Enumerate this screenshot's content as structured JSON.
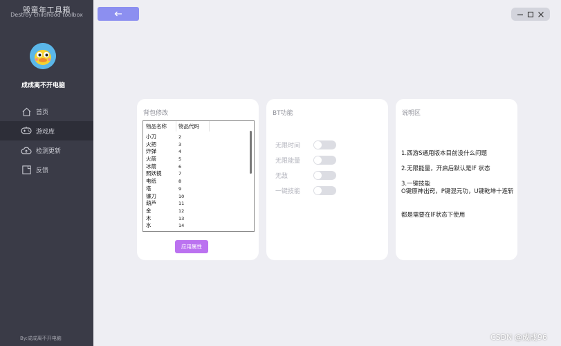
{
  "app": {
    "title": "毁童年工具箱",
    "subtitle": "Destroy childhood toolbox"
  },
  "user": {
    "name": "成成离不开电脑"
  },
  "sidebar": {
    "items": [
      {
        "label": "首页",
        "icon": "home-icon"
      },
      {
        "label": "游戏库",
        "icon": "gamepad-icon"
      },
      {
        "label": "检测更新",
        "icon": "cloud-icon"
      },
      {
        "label": "反馈",
        "icon": "feedback-icon"
      }
    ],
    "active_index": 1,
    "footer": "By:成成离不开电脑"
  },
  "backpack": {
    "title": "背包修改",
    "headers": [
      "物品名称",
      "物品代码"
    ],
    "rows": [
      [
        "小刀",
        "2"
      ],
      [
        "火把",
        "3"
      ],
      [
        "炸弹",
        "4"
      ],
      [
        "火箭",
        "5"
      ],
      [
        "冰箭",
        "6"
      ],
      [
        "照妖镜",
        "7"
      ],
      [
        "电纸",
        "8"
      ],
      [
        "塔",
        "9"
      ],
      [
        "镰刀",
        "10"
      ],
      [
        "葫芦",
        "11"
      ],
      [
        "金",
        "12"
      ],
      [
        "木",
        "13"
      ],
      [
        "水",
        "14"
      ]
    ],
    "apply_label": "应用属性"
  },
  "bt": {
    "title": "BT功能",
    "toggles": [
      {
        "label": "无限时间",
        "on": false
      },
      {
        "label": "无限能量",
        "on": false
      },
      {
        "label": "无敌",
        "on": false
      },
      {
        "label": "一键技能",
        "on": false
      }
    ]
  },
  "instructions": {
    "title": "说明区",
    "lines": [
      "1.西游S通用版本目前没什么问题",
      "2.无限能量，开启后默认是lF 状态",
      "3.一键技能\nO键原神出窍，P键混元功，U键乾坤十连斩",
      "都是需要在lF状态下使用"
    ]
  },
  "watermark": "CSDN @成成96",
  "colors": {
    "sidebar_bg": "#3a3b47",
    "accent": "#8c8ff0",
    "apply_button": "#bb72f0",
    "page_bg": "#eeeef3"
  }
}
